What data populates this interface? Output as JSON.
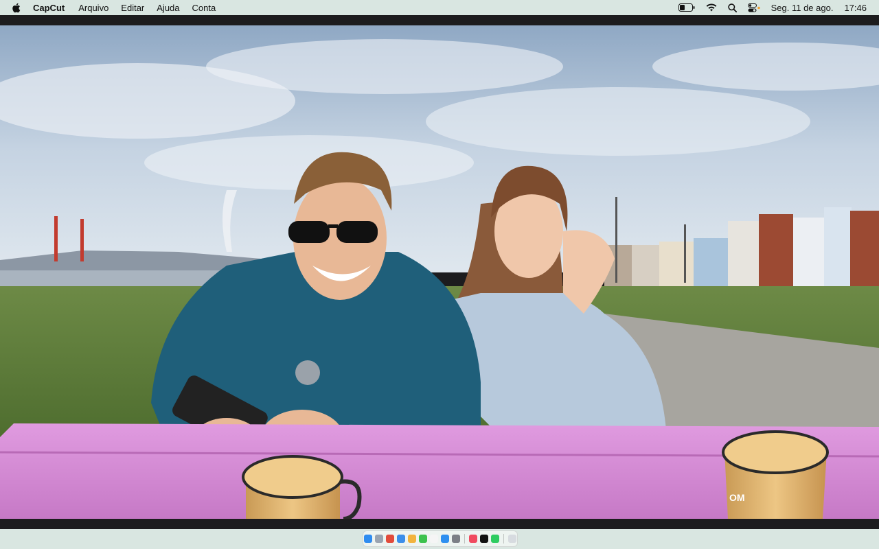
{
  "menubar": {
    "app_name": "CapCut",
    "menus": [
      "Arquivo",
      "Editar",
      "Ajuda",
      "Conta"
    ],
    "date": "Seg. 11 de ago.",
    "time": "17:46",
    "icons": [
      "apple-logo",
      "battery-icon",
      "wifi-icon",
      "search-icon",
      "control-center-icon"
    ]
  },
  "video": {
    "description_colors": {
      "sky": "#c9d6e3",
      "grass": "#5a7a3a",
      "table": "#d68bd3",
      "mug": "#e2b46c",
      "jacket": "#1f5f7a",
      "denim": "#b7c9dc"
    },
    "mug_logo": "OM"
  },
  "dock": {
    "icons": [
      {
        "name": "finder-icon",
        "color": "#2f8cf0"
      },
      {
        "name": "launchpad-icon",
        "color": "#9aa4b1"
      },
      {
        "name": "chrome-icon",
        "color": "#e24b3b"
      },
      {
        "name": "safari-icon",
        "color": "#3b8eea"
      },
      {
        "name": "chrome-alt-icon",
        "color": "#f2b33d"
      },
      {
        "name": "facetime-icon",
        "color": "#3cc24d"
      },
      {
        "name": "calendar-icon",
        "color": "#f5f5f5"
      },
      {
        "name": "app-store-icon",
        "color": "#2e8ff0"
      },
      {
        "name": "settings-icon",
        "color": "#7c7f86"
      },
      {
        "name": "music-icon",
        "color": "#f04a5f"
      },
      {
        "name": "capcut-icon",
        "color": "#111111"
      },
      {
        "name": "whatsapp-icon",
        "color": "#2ecc61"
      },
      {
        "name": "trash-icon",
        "color": "#d7dbe0"
      }
    ]
  }
}
